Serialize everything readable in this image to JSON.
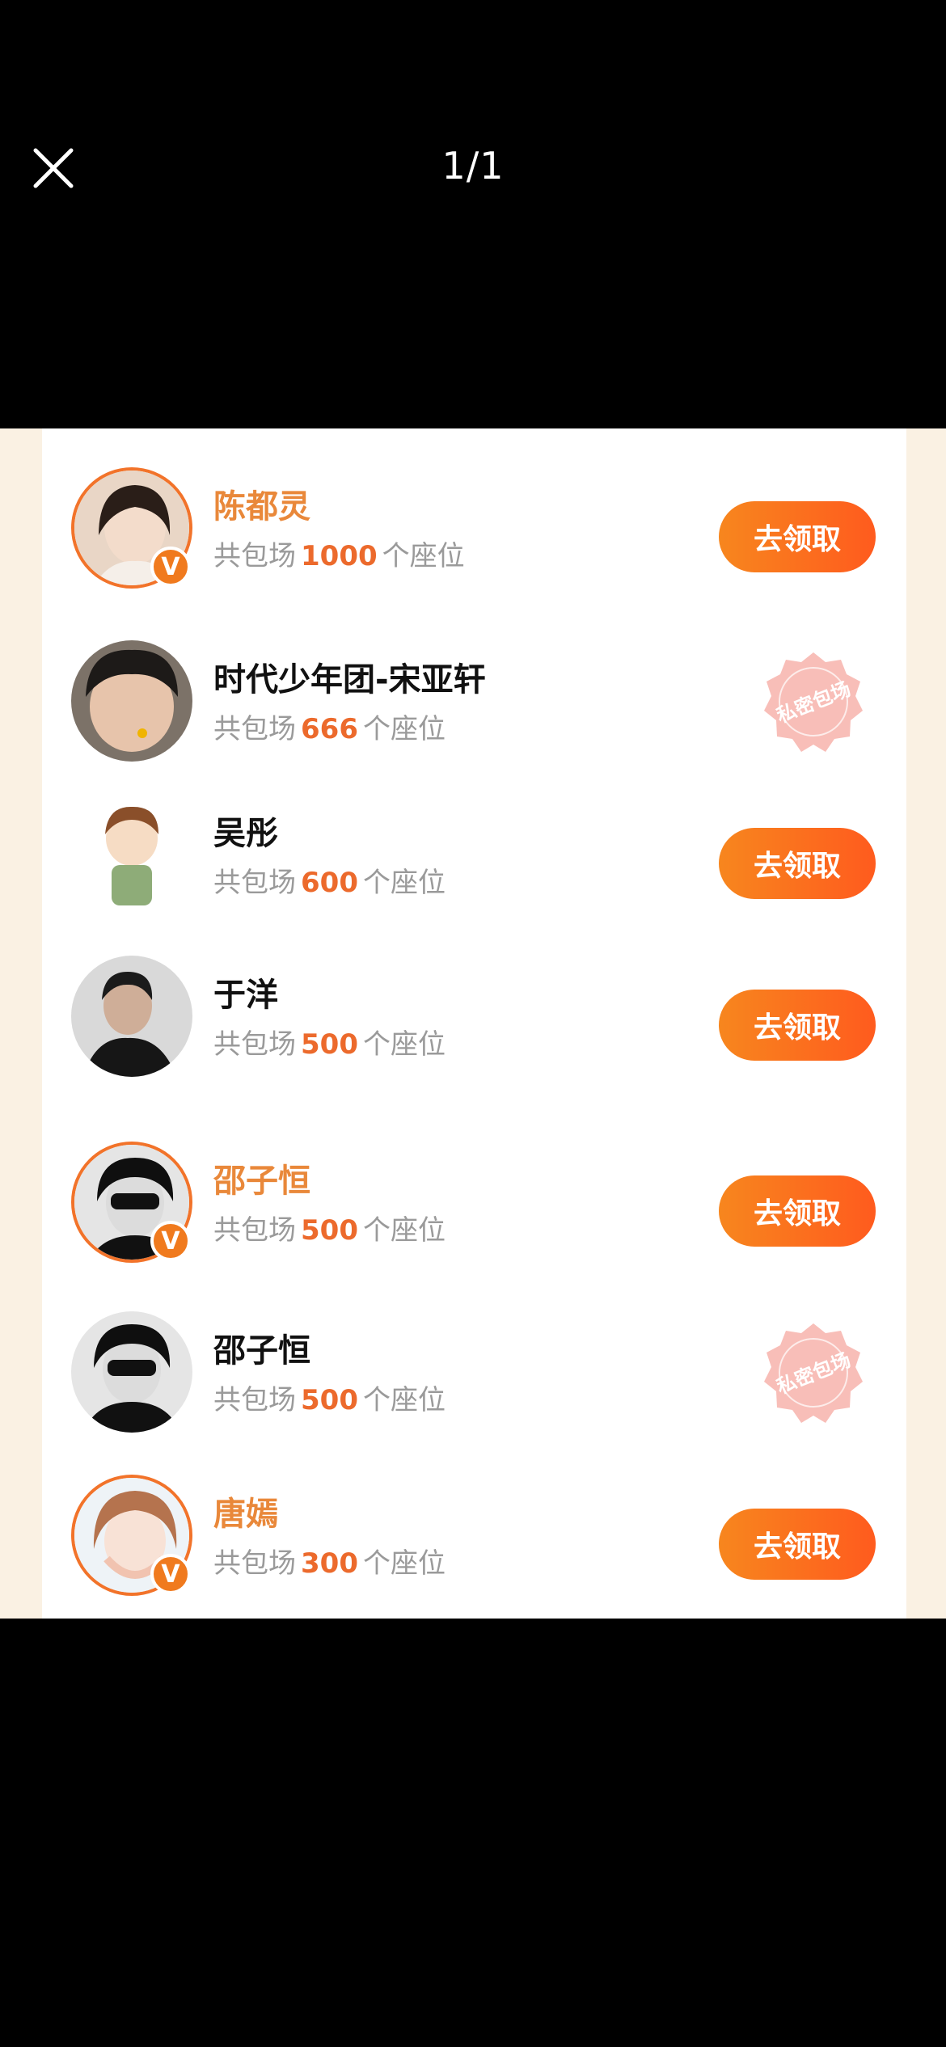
{
  "viewer": {
    "page_counter": "1/1",
    "close_icon": "close-icon"
  },
  "list": {
    "sub_prefix": "共包场",
    "sub_suffix": "个座位",
    "claim_label": "去领取",
    "stamp_text": "私密包场",
    "items": [
      {
        "name": "陈都灵",
        "count": "1000",
        "verified": true,
        "action": "claim"
      },
      {
        "name": "时代少年团-宋亚轩",
        "count": "666",
        "verified": false,
        "action": "private"
      },
      {
        "name": "吴彤",
        "count": "600",
        "verified": false,
        "action": "claim"
      },
      {
        "name": "于洋",
        "count": "500",
        "verified": false,
        "action": "claim"
      },
      {
        "name": "邵子恒",
        "count": "500",
        "verified": true,
        "action": "claim"
      },
      {
        "name": "邵子恒",
        "count": "500",
        "verified": false,
        "action": "private"
      },
      {
        "name": "唐嫣",
        "count": "300",
        "verified": true,
        "action": "claim"
      }
    ]
  },
  "colors": {
    "accent": "#f7861e",
    "accent_end": "#ff5b1e",
    "count": "#ec6a2c",
    "verified_name": "#e9883a",
    "stamp": "#f4a6a0",
    "page_bg": "#faf1e3"
  }
}
